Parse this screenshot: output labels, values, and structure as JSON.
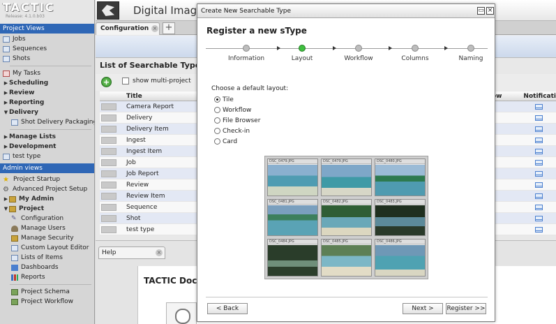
{
  "app": {
    "logo_text": "TACTIC",
    "release": "Release: 4.1.0.b03",
    "header_title": "Digital Imaging"
  },
  "sidebar": {
    "project_views_header": "Project Views",
    "project_views": [
      {
        "label": "Jobs",
        "icon": "grid-icon"
      },
      {
        "label": "Sequences",
        "icon": "grid-icon"
      },
      {
        "label": "Shots",
        "icon": "grid-icon"
      }
    ],
    "groups": [
      {
        "label": "My Tasks",
        "icon": "calendar-icon"
      },
      {
        "label": "Scheduling",
        "collapsed": true
      },
      {
        "label": "Review",
        "collapsed": true
      },
      {
        "label": "Reporting",
        "collapsed": true
      },
      {
        "label": "Delivery",
        "expanded": true
      }
    ],
    "delivery_child": "Shot Delivery Packaging",
    "groups2": [
      {
        "label": "Manage Lists"
      },
      {
        "label": "Development"
      }
    ],
    "test_type": "test type",
    "admin_views_header": "Admin views",
    "admin_items": [
      {
        "label": "Project Startup",
        "icon": "star-icon"
      },
      {
        "label": "Advanced Project Setup",
        "icon": "gear-icon"
      },
      {
        "label": "My Admin",
        "icon": "folder-icon"
      },
      {
        "label": "Project",
        "icon": "folder-icon"
      }
    ],
    "project_children": [
      {
        "label": "Configuration",
        "icon": "wrench-icon"
      },
      {
        "label": "Manage Users",
        "icon": "users-icon"
      },
      {
        "label": "Manage Security",
        "icon": "lock-icon"
      },
      {
        "label": "Custom Layout Editor",
        "icon": "grid-icon"
      },
      {
        "label": "Lists of Items",
        "icon": "grid-icon"
      },
      {
        "label": "Dashboards",
        "icon": "dashboard-icon"
      },
      {
        "label": "Reports",
        "icon": "chart-icon"
      }
    ],
    "bottom_items": [
      {
        "label": "Project Schema",
        "icon": "tree-icon"
      },
      {
        "label": "Project Workflow",
        "icon": "tree-icon"
      }
    ]
  },
  "main": {
    "tab_label": "Configuration",
    "list_title": "List of Searchable Types (s",
    "show_multi_project": "show multi-project",
    "col_title": "Title",
    "col_workflow_partial": "ow",
    "col_notification": "Notificati",
    "rows": [
      "Camera Report",
      "Delivery",
      "Delivery Item",
      "Ingest",
      "Ingest Item",
      "Job",
      "Job Report",
      "Review",
      "Review Item",
      "Sequence",
      "Shot",
      "test type"
    ],
    "help_tab": "Help",
    "help_heading": "TACTIC Docu"
  },
  "modal": {
    "window_title": "Create New Searchable Type",
    "heading": "Register a new sType",
    "steps": [
      "Information",
      "Layout",
      "Workflow",
      "Columns",
      "Naming"
    ],
    "active_step": 1,
    "choose_label": "Choose a default layout:",
    "layout_options": [
      "Tile",
      "Workflow",
      "File Browser",
      "Check-in",
      "Card"
    ],
    "selected_option": 0,
    "preview_captions": [
      "DSC_0479.JPG",
      "DSC_0479.JPG",
      "DSC_0480.JPG",
      "DSC_0481.JPG",
      "DSC_0482.JPG",
      "DSC_0483.JPG",
      "DSC_0484.JPG",
      "DSC_0485.JPG",
      "DSC_0486.JPG"
    ],
    "back_button": "< Back",
    "next_button": "Next >",
    "register_button": "Register >>"
  }
}
